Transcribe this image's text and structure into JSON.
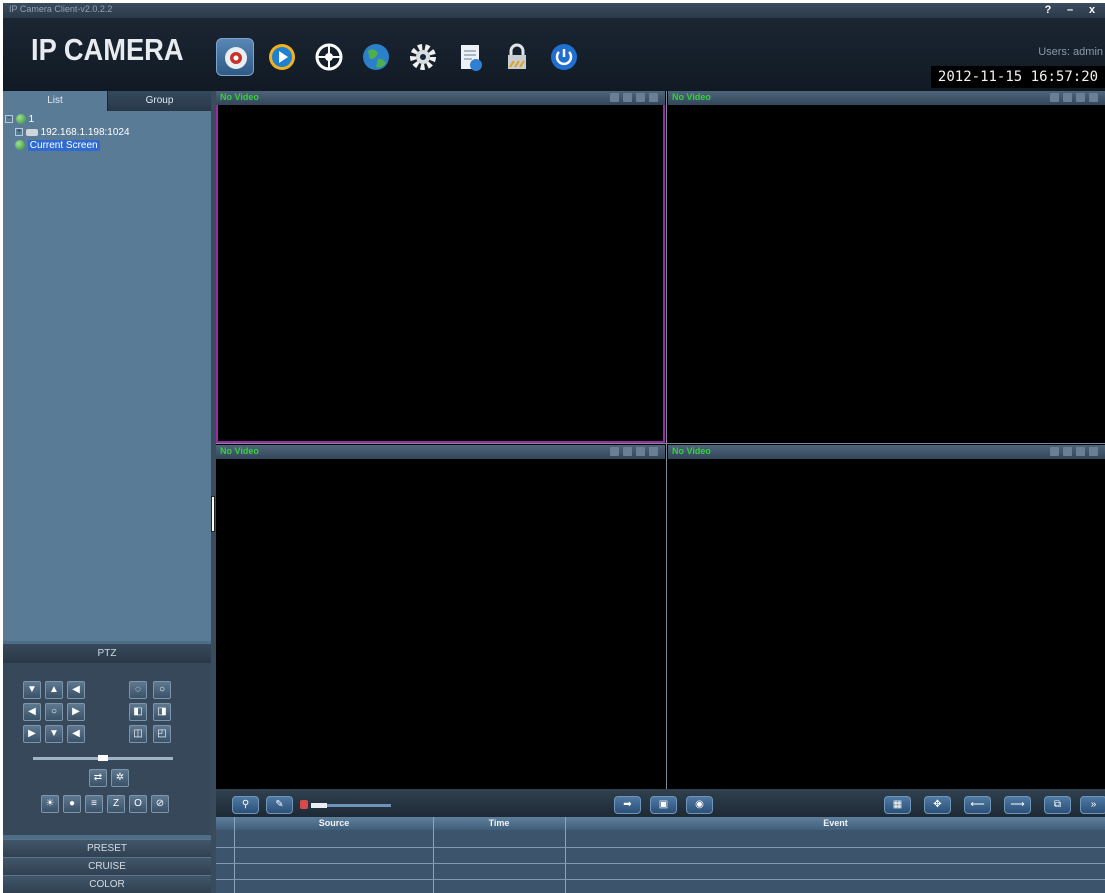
{
  "window": {
    "title": "IP Camera Client-v2.0.2.2",
    "help": "?",
    "minimize": "–",
    "close": "x"
  },
  "header": {
    "logo": "IP CAMERA",
    "users": "Users: admin",
    "datetime": "2012-11-15 16:57:20",
    "tools": [
      "live-view-icon",
      "playback-icon",
      "ptz-control-icon",
      "network-globe-icon",
      "settings-gear-icon",
      "log-document-icon",
      "lock-icon",
      "power-icon"
    ]
  },
  "sidebar": {
    "tabs": [
      "List",
      "Group"
    ],
    "tree": {
      "root": "1",
      "device": "192.168.1.198:1024",
      "current": "Current Screen"
    },
    "ptz_title": "PTZ",
    "sections": [
      "PRESET",
      "CRUISE",
      "COLOR"
    ]
  },
  "video": {
    "panes": [
      {
        "status": "No Video"
      },
      {
        "status": "No Video"
      },
      {
        "status": "No Video"
      },
      {
        "status": "No Video"
      }
    ],
    "volume_level": 0.2
  },
  "log": {
    "columns": [
      "Source",
      "Time",
      "Event"
    ]
  },
  "colors": {
    "no_video": "#34d23c",
    "selected_pane": "#9a2aa8",
    "panel": "#5a7b96",
    "button": "#3f6a94"
  }
}
